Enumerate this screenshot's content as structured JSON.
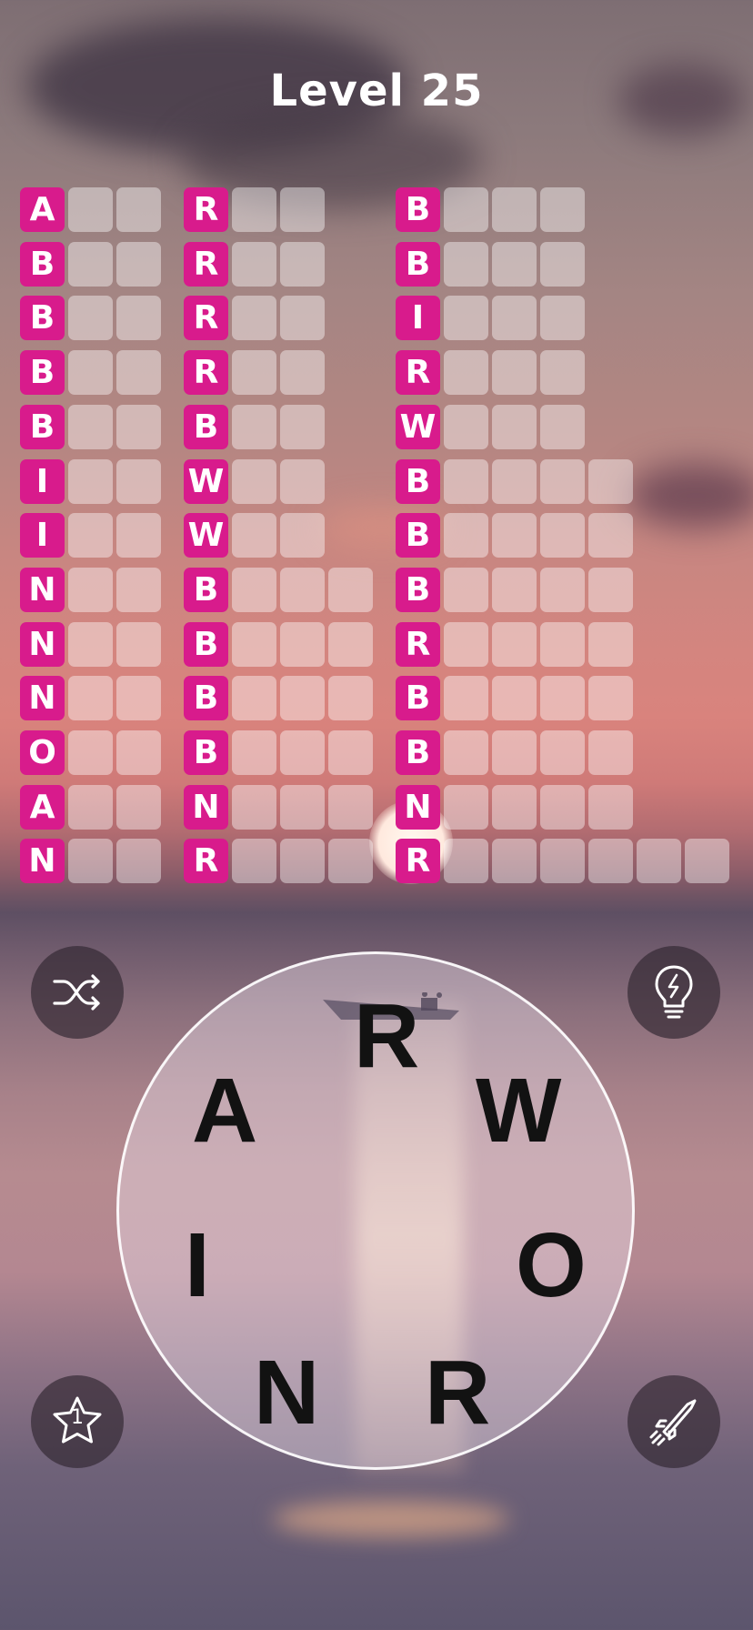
{
  "header": {
    "level_title": "Level 25"
  },
  "columns": [
    {
      "rows": [
        {
          "letter": "A",
          "blanks": 2
        },
        {
          "letter": "B",
          "blanks": 2
        },
        {
          "letter": "B",
          "blanks": 2
        },
        {
          "letter": "B",
          "blanks": 2
        },
        {
          "letter": "B",
          "blanks": 2
        },
        {
          "letter": "I",
          "blanks": 2
        },
        {
          "letter": "I",
          "blanks": 2
        },
        {
          "letter": "N",
          "blanks": 2
        },
        {
          "letter": "N",
          "blanks": 2
        },
        {
          "letter": "N",
          "blanks": 2
        },
        {
          "letter": "O",
          "blanks": 2
        },
        {
          "letter": "A",
          "blanks": 2
        },
        {
          "letter": "N",
          "blanks": 2
        }
      ]
    },
    {
      "rows": [
        {
          "letter": "R",
          "blanks": 2
        },
        {
          "letter": "R",
          "blanks": 2
        },
        {
          "letter": "R",
          "blanks": 2
        },
        {
          "letter": "R",
          "blanks": 2
        },
        {
          "letter": "B",
          "blanks": 2
        },
        {
          "letter": "W",
          "blanks": 2
        },
        {
          "letter": "W",
          "blanks": 2
        },
        {
          "letter": "B",
          "blanks": 3
        },
        {
          "letter": "B",
          "blanks": 3
        },
        {
          "letter": "B",
          "blanks": 3
        },
        {
          "letter": "B",
          "blanks": 3
        },
        {
          "letter": "N",
          "blanks": 3
        },
        {
          "letter": "R",
          "blanks": 3
        }
      ]
    },
    {
      "rows": [
        {
          "letter": "B",
          "blanks": 3
        },
        {
          "letter": "B",
          "blanks": 3
        },
        {
          "letter": "I",
          "blanks": 3
        },
        {
          "letter": "R",
          "blanks": 3
        },
        {
          "letter": "W",
          "blanks": 3
        },
        {
          "letter": "B",
          "blanks": 4
        },
        {
          "letter": "B",
          "blanks": 4
        },
        {
          "letter": "B",
          "blanks": 4
        },
        {
          "letter": "R",
          "blanks": 4
        },
        {
          "letter": "B",
          "blanks": 4
        },
        {
          "letter": "B",
          "blanks": 4
        },
        {
          "letter": "N",
          "blanks": 4
        },
        {
          "letter": "R",
          "blanks": 6
        }
      ]
    }
  ],
  "wheel": {
    "letters": [
      "R",
      "W",
      "O",
      "R",
      "N",
      "I",
      "A"
    ]
  },
  "buttons": {
    "shuffle": {
      "icon": "shuffle-icon"
    },
    "hint": {
      "icon": "lightbulb-icon"
    },
    "bonus": {
      "icon": "star-icon",
      "count": "1"
    },
    "rocket": {
      "icon": "rocket-icon"
    }
  }
}
